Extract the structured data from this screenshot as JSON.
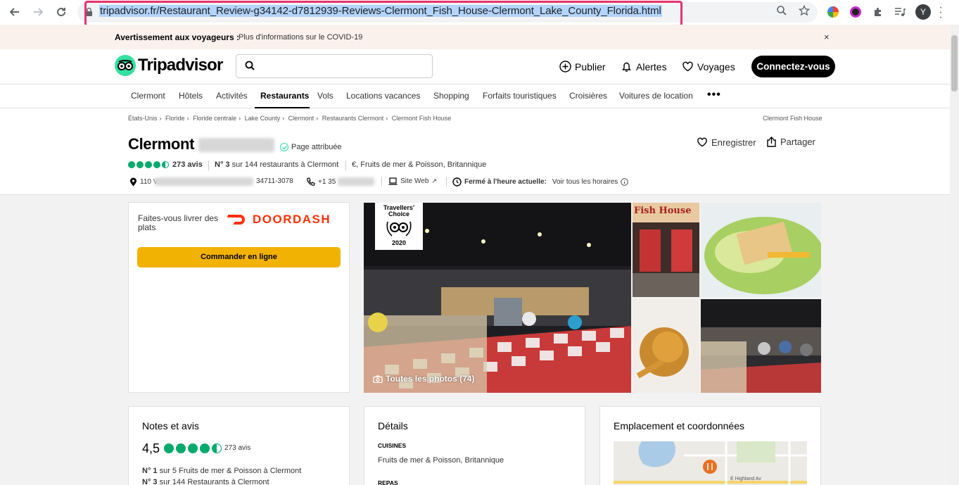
{
  "browser": {
    "url": "tripadvisor.fr/Restaurant_Review-g34142-d7812939-Reviews-Clermont_Fish_House-Clermont_Lake_County_Florida.html",
    "profile_initial": "Y"
  },
  "banner": {
    "strong": "Avertissement aux voyageurs :",
    "rest": "Plus d'informations sur le COVID-19",
    "close": "×"
  },
  "header": {
    "logo": "Tripadvisor",
    "publish": "Publier",
    "alerts": "Alertes",
    "trips": "Voyages",
    "signin": "Connectez-vous"
  },
  "topnav": {
    "items": [
      "Clermont",
      "Hôtels",
      "Activités",
      "Restaurants",
      "Vols",
      "Locations vacances",
      "Shopping",
      "Forfaits touristiques",
      "Croisières",
      "Voitures de location"
    ],
    "more": "•••"
  },
  "breadcrumbs": [
    "États-Unis",
    "Floride",
    "Floride centrale",
    "Lake County",
    "Clermont",
    "Restaurants Clermont",
    "Clermont Fish House"
  ],
  "breadcrumb_right": "Clermont Fish House",
  "restaurant": {
    "name_visible": "Clermont",
    "attributed": "Page attribuée",
    "save": "Enregistrer",
    "share": "Partager",
    "reviews": "273 avis",
    "rank": "N° 3",
    "rank_rest": "sur 144 restaurants à Clermont",
    "cuisine": "€, Fruits de mer & Poisson, Britannique",
    "address_start": "110 V",
    "address_end": "34711-3078",
    "phone_start": "+1 35",
    "website": "Site Web",
    "closed": "Fermé à l'heure actuelle:",
    "hours": "Voir tous les horaires"
  },
  "delivery": {
    "text": "Faites-vous livrer des plats",
    "brand": "DOORDASH",
    "button": "Commander en ligne"
  },
  "photos": {
    "badge_line1": "Travellers'",
    "badge_line2": "Choice",
    "badge_year": "2020",
    "all_photos": "Toutes les photos (74)",
    "sign_text": "Fish House"
  },
  "ratings_card": {
    "title": "Notes et avis",
    "score": "4,5",
    "reviews": "273 avis",
    "rank1_bold": "N° 1",
    "rank1_rest": "sur 5 Fruits de mer & Poisson à Clermont",
    "rank2_bold": "N° 3",
    "rank2_rest": "sur 144 Restaurants à Clermont"
  },
  "details_card": {
    "title": "Détails",
    "cuisines_label": "CUISINES",
    "cuisines_value": "Fruits de mer & Poisson, Britannique",
    "meals_label": "REPAS"
  },
  "location_card": {
    "title": "Emplacement et coordonnées",
    "street": "E Highland Av"
  },
  "colors": {
    "brand_green": "#34e0a1",
    "bubble_green": "#00aa6c",
    "doordash_red": "#ff3008",
    "order_yellow": "#f2b203",
    "highlight_pink": "#e6336b"
  }
}
